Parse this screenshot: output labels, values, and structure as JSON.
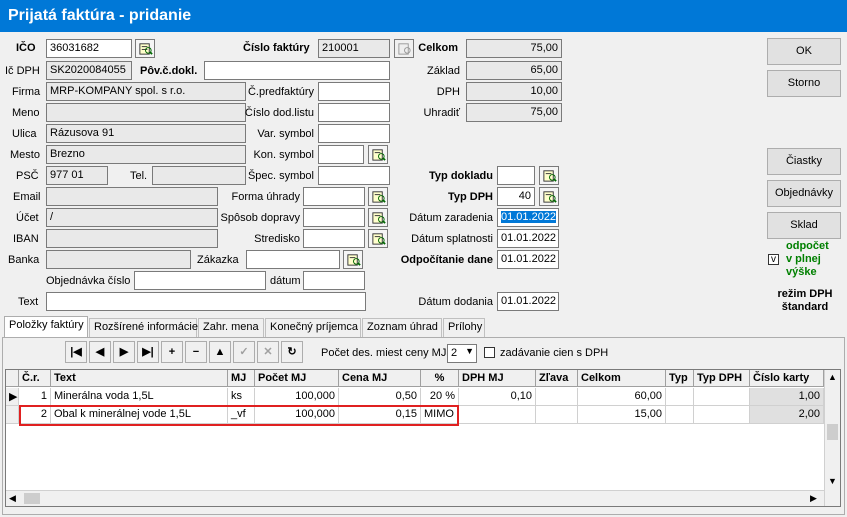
{
  "window": {
    "title": "Prijatá faktúra  - pridanie"
  },
  "supplier": {
    "ico_label": "IČO",
    "ico": "36031682",
    "icdph_label": "Ič DPH",
    "icdph": "SK2020084055",
    "povcdokl_label": "Pôv.č.dokl.",
    "povcdokl": "",
    "firma_label": "Firma",
    "firma": "MRP-KOMPANY spol. s r.o.",
    "meno_label": "Meno",
    "meno": "",
    "ulica_label": "Ulica",
    "ulica": "Rázusova 91",
    "mesto_label": "Mesto",
    "mesto": "Brezno",
    "psc_label": "PSČ",
    "psc": "977 01",
    "tel_label": "Tel.",
    "tel": "",
    "email_label": "Email",
    "email": "",
    "ucet_label": "Účet",
    "ucet": "/",
    "iban_label": "IBAN",
    "iban": "",
    "banka_label": "Banka",
    "banka": "",
    "objednavka_label": "Objednávka číslo",
    "objednavka": "",
    "datum_label": "dátum",
    "datum": "",
    "text_label": "Text",
    "text": ""
  },
  "invoice": {
    "cislo_label": "Číslo faktúry",
    "cislo": "210001",
    "predfaktury_label": "Č.predfaktúry",
    "predfaktury": "",
    "doddlistu_label": "Číslo dod.listu",
    "doddlistu": "",
    "varsymbol_label": "Var. symbol",
    "varsymbol": "",
    "konsymbol_label": "Kon. symbol",
    "konsymbol": "",
    "specsymbol_label": "Špec. symbol",
    "specsymbol": "",
    "formauhrady_label": "Forma úhrady",
    "formauhrady": "",
    "sposobdopravy_label": "Spôsob dopravy",
    "sposobdopravy": "",
    "stredisko_label": "Stredisko",
    "stredisko": "",
    "zakazka_label": "Zákazka",
    "zakazka": ""
  },
  "totals": {
    "celkom_label": "Celkom",
    "celkom": "75,00",
    "zaklad_label": "Základ",
    "zaklad": "65,00",
    "dph_label": "DPH",
    "dph": "10,00",
    "uhradit_label": "Uhradiť",
    "uhradit": "75,00"
  },
  "doc": {
    "typdokladu_label": "Typ dokladu",
    "typdokladu": "",
    "typdph_label": "Typ DPH",
    "typdph": "40",
    "datumzaradenia_label": "Dátum zaradenia",
    "datumzaradenia": "01.01.2022",
    "datumsplatnosti_label": "Dátum splatnosti",
    "datumsplatnosti": "01.01.2022",
    "odpocitanie_label": "Odpočítanie dane",
    "odpocitanie": "01.01.2022",
    "datumdodania_label": "Dátum dodania",
    "datumdodania": "01.01.2022"
  },
  "buttons": {
    "ok": "OK",
    "storno": "Storno",
    "ciastky": "Čiastky",
    "objednavky": "Objednávky",
    "sklad": "Sklad"
  },
  "odpocet": {
    "line1": "odpočet",
    "line2": "v plnej",
    "line3": "výške",
    "checked": "v"
  },
  "rezim": {
    "line1": "režim DPH",
    "line2": "štandard"
  },
  "tabs": [
    "Položky faktúry",
    "Rozšírené informácie",
    "Zahr. mena",
    "Konečný príjemca",
    "Zoznam úhrad",
    "Prílohy"
  ],
  "toolbar": {
    "pocet_label": "Počet des. miest ceny MJ",
    "pocet_value": "2",
    "zadavanie_label": "zadávanie cien s DPH"
  },
  "nav_glyphs": [
    "|◀",
    "◀",
    "▶",
    "▶|",
    "+",
    "−",
    "▲",
    "✓",
    "✕",
    "↻"
  ],
  "table": {
    "headers": [
      "Č.r.",
      "Text",
      "MJ",
      "Počet MJ",
      "Cena MJ",
      "%",
      "DPH MJ",
      "Zľava",
      "Celkom",
      "Typ",
      "Typ DPH",
      "Číslo karty"
    ],
    "rows": [
      [
        "1",
        "Minerálna voda 1,5L",
        "ks",
        "100,000",
        "0,50",
        "20 %",
        "0,10",
        "",
        "60,00",
        "",
        "",
        "1,00"
      ],
      [
        "2",
        "Obal k minerálnej vode 1,5L",
        "_vf",
        "100,000",
        "0,15",
        "MIMO",
        "",
        "",
        "15,00",
        "",
        "",
        "2,00"
      ]
    ]
  }
}
